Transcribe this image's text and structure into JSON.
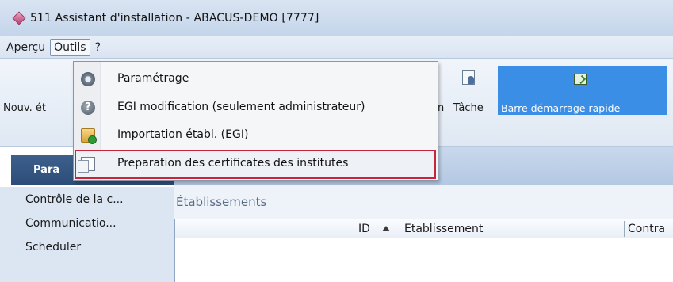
{
  "window": {
    "title": "511 Assistant d'installation - ABACUS-DEMO [7777]"
  },
  "menubar": {
    "items": [
      "Aperçu",
      "Outils",
      "?"
    ]
  },
  "toolbar": {
    "nouv_label": "Nouv. ét",
    "n_label": "n",
    "tache_label": "Tâche",
    "quick_label": "Barre démarrage rapide"
  },
  "dropdown": {
    "items": [
      {
        "label": "Paramétrage",
        "icon": "gear-icon"
      },
      {
        "label": "EGI modification (seulement administrateur)",
        "icon": "help-icon"
      },
      {
        "label": "Importation établ. (EGI)",
        "icon": "import-icon"
      },
      {
        "label": "Preparation des certificates des institutes",
        "icon": "copy-icon",
        "highlighted": true
      }
    ]
  },
  "nav": {
    "header": "Para",
    "items": [
      "Contrôle de la c...",
      "Communicatio...",
      "Scheduler"
    ]
  },
  "main": {
    "group_label": "Établissements",
    "grid": {
      "columns": [
        "ID",
        "Etablissement",
        "Contra"
      ],
      "sort_column": "ID",
      "sort_direction": "ascending"
    }
  },
  "colors": {
    "highlight_border": "#c8253a",
    "quick_bar": "#3a8ee6"
  }
}
